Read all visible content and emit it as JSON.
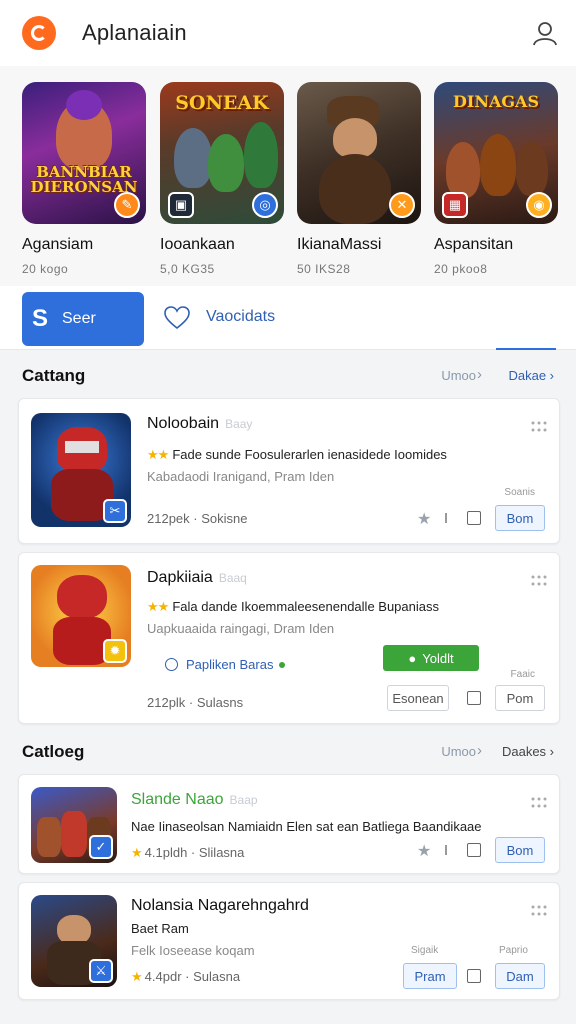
{
  "header": {
    "title": "Aplanaiain"
  },
  "featured": [
    {
      "name": "Agansiam",
      "meta": "20 kogo",
      "art_text": "BANNBIAR DIERONSAN",
      "art_top": ""
    },
    {
      "name": "Iooankaan",
      "meta": "5,0 KG35",
      "art_text": "",
      "art_top": "SONEAK"
    },
    {
      "name": "IkianaMassi",
      "meta": "50 IKS28",
      "art_text": "",
      "art_top": ""
    },
    {
      "name": "Aspansitan",
      "meta": "20 pkoo8",
      "art_text": "",
      "art_top": "DINAGAS"
    }
  ],
  "actions": {
    "primary": "Seer",
    "secondary": "Vaocidats"
  },
  "section1": {
    "title": "Cattang",
    "more": "Umoo",
    "link": "Dakae"
  },
  "section2": {
    "title": "Catloeg",
    "more": "Umoo",
    "link": "Daakes"
  },
  "cards": [
    {
      "title": "Noloobain",
      "subtitle": "Baay",
      "desc": "Fade sunde Foosulerarlen ienasidede Ioomides",
      "desc2": "Kabadaodi Iranigand, Pram Iden",
      "meta": "212pek · Sokisne",
      "tiny": "Soanis",
      "btn": "Bom"
    },
    {
      "title": "Dapkiiaia",
      "subtitle": "Baaq",
      "desc": "Fala dande Ikoemmaleesenendalle Bupaniass",
      "desc2": "Uapkuaaida raingagi, Dram Iden",
      "verified": "Papliken Baras",
      "green_btn": "Yoldlt",
      "meta": "212plk · Sulasns",
      "tiny": "Faaic",
      "gray_btn": "Esonean",
      "btn": "Pom"
    },
    {
      "title": "Slande Naao",
      "subtitle": "Baap",
      "desc": "Nae Iinaseolsan Namiaidn Elen sat ean Batliega Baandikaae",
      "meta": "4.1pldh · Slilasna",
      "btn": "Bom"
    },
    {
      "title": "Nolansia Nagarehngahrd",
      "subtitle": "",
      "desc": "Baet Ram",
      "desc2": "Felk Ioseease koqam",
      "meta": "4.4pdr · Sulasna",
      "tiny": "Sigaik",
      "tiny2": "Paprio",
      "btn_a": "Pram",
      "btn": "Dam"
    }
  ],
  "colors": {
    "accent": "#2f6fdb",
    "brand": "#ff6a1f",
    "star": "#f5b400",
    "success": "#3ca53a"
  }
}
